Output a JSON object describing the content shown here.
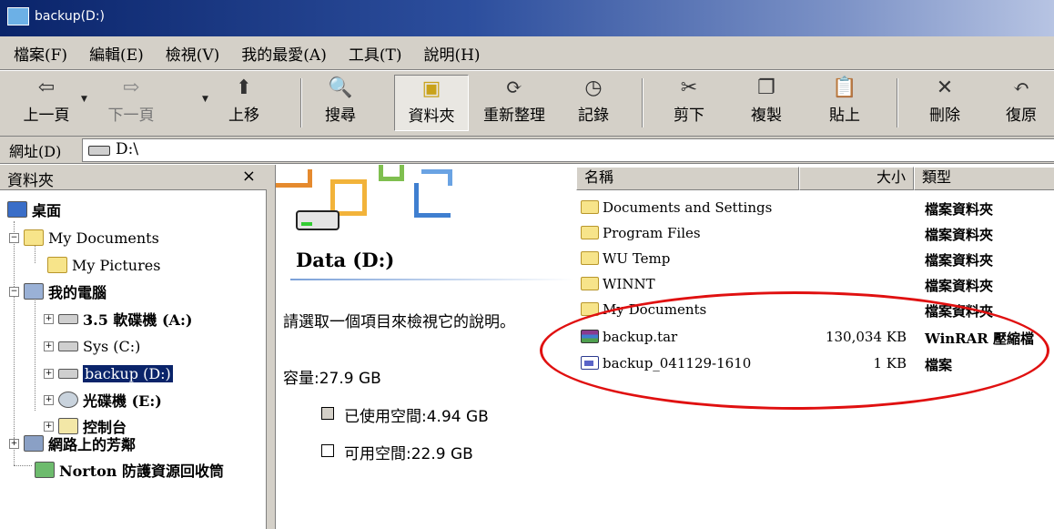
{
  "window": {
    "title": "backup(D:)"
  },
  "menu": [
    "檔案(F)",
    "編輯(E)",
    "檢視(V)",
    "我的最愛(A)",
    "工具(T)",
    "說明(H)"
  ],
  "toolbar": {
    "back": "上一頁",
    "forward": "下一頁",
    "up": "上移",
    "search": "搜尋",
    "folders": "資料夾",
    "history_reorg": "重新整理",
    "history": "記錄",
    "cut": "剪下",
    "copy": "複製",
    "paste": "貼上",
    "delete": "刪除",
    "undo": "復原"
  },
  "address": {
    "label": "網址(D)",
    "value": "D:\\"
  },
  "folder_pane": {
    "title": "資料夾",
    "close": "×",
    "items": [
      {
        "label": "桌面",
        "icon": "desktop-icon"
      },
      {
        "label": "My Documents",
        "icon": "my-documents-icon"
      },
      {
        "label": "My Pictures",
        "icon": "folder-icon"
      },
      {
        "label": "我的電腦",
        "icon": "my-computer-icon"
      },
      {
        "label": "3.5 軟碟機 (A:)",
        "icon": "floppy-drive-icon"
      },
      {
        "label": "Sys (C:)",
        "icon": "hard-drive-icon"
      },
      {
        "label": "backup (D:)",
        "icon": "hard-drive-icon"
      },
      {
        "label": "光碟機 (E:)",
        "icon": "cd-drive-icon"
      },
      {
        "label": "控制台",
        "icon": "control-panel-icon"
      },
      {
        "label": "網路上的芳鄰",
        "icon": "network-icon"
      },
      {
        "label": "Norton 防護資源回收筒",
        "icon": "recycle-bin-icon"
      }
    ]
  },
  "webview": {
    "drive_title": "Data (D:)",
    "prompt": "請選取一個項目來檢視它的說明。",
    "capacity": "容量:27.9 GB",
    "used": "已使用空間:4.94 GB",
    "free": "可用空間:22.9 GB"
  },
  "columns": {
    "name": "名稱",
    "size": "大小",
    "type": "類型"
  },
  "files": [
    {
      "name": "Documents and Settings",
      "size": "",
      "type": "檔案資料夾",
      "icon": "folder-icon"
    },
    {
      "name": "Program Files",
      "size": "",
      "type": "檔案資料夾",
      "icon": "folder-icon"
    },
    {
      "name": "WU Temp",
      "size": "",
      "type": "檔案資料夾",
      "icon": "folder-icon"
    },
    {
      "name": "WINNT",
      "size": "",
      "type": "檔案資料夾",
      "icon": "folder-icon"
    },
    {
      "name": "My Documents",
      "size": "",
      "type": "檔案資料夾",
      "icon": "folder-icon"
    },
    {
      "name": "backup.tar",
      "size": "130,034 KB",
      "type": "WinRAR 壓縮檔",
      "icon": "winrar-archive-icon"
    },
    {
      "name": "backup_041129-1610",
      "size": "1 KB",
      "type": "檔案",
      "icon": "batch-file-icon"
    }
  ],
  "colors": {
    "title_bar": "#0a246a",
    "selection": "#0a246a",
    "annotation_ellipse": "#e01010",
    "chrome": "#d4d0c8"
  }
}
